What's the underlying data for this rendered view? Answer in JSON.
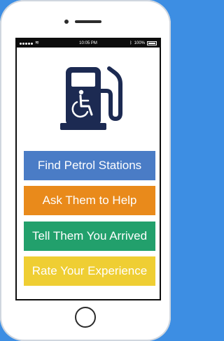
{
  "status_bar": {
    "time": "10:05 PM",
    "battery": "100%",
    "wifi_icon": "wifi-icon",
    "bluetooth_icon": "bluetooth-icon"
  },
  "logo": {
    "icon": "accessible-petrol-pump-icon",
    "color": "#1c2a52"
  },
  "buttons": [
    {
      "label": "Find Petrol Stations",
      "color": "#4a7cc6"
    },
    {
      "label": "Ask Them to Help",
      "color": "#e98a1b"
    },
    {
      "label": "Tell Them You Arrived",
      "color": "#22a06c"
    },
    {
      "label": "Rate Your Experience",
      "color": "#efce33"
    }
  ]
}
